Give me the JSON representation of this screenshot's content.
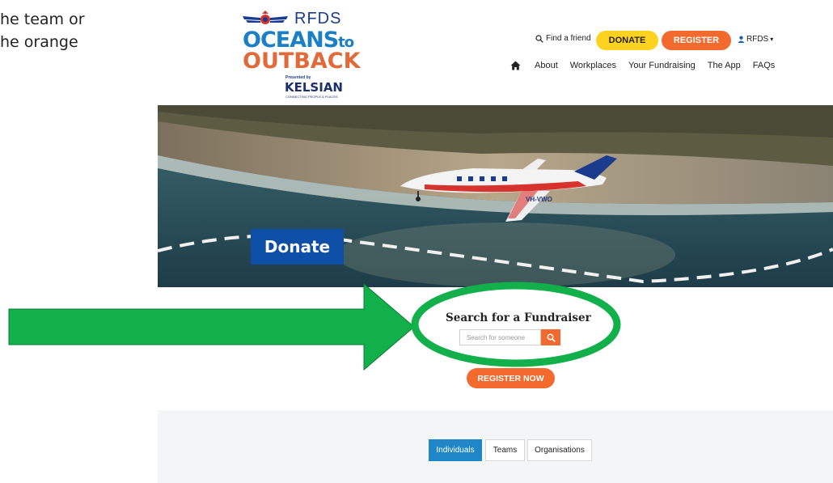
{
  "doc_fragment": {
    "line1": "he team or",
    "line2": "he orange"
  },
  "logo": {
    "rfds": "RFDS",
    "oceans": "OCEANS",
    "to": "to",
    "outback": "OUTBACK",
    "presented_by": "Presented by",
    "sponsor": "KELSIAN",
    "tagline": "CONNECTING PEOPLE & PLACES"
  },
  "top_nav": {
    "find_friend": "Find a friend",
    "donate": "DONATE",
    "register": "REGISTER",
    "user": "RFDS"
  },
  "main_nav": {
    "items": [
      "About",
      "Workplaces",
      "Your Fundraising",
      "The App",
      "FAQs"
    ]
  },
  "hero": {
    "banner": "Donate",
    "plane_reg": "VH-VWO"
  },
  "search": {
    "title": "Search for a Fundraiser",
    "placeholder": "Search for someone"
  },
  "cta": {
    "register_now": "REGISTER NOW"
  },
  "tabs": {
    "items": [
      "Individuals",
      "Teams",
      "Organisations"
    ],
    "active": "Individuals"
  },
  "colors": {
    "accent_orange": "#f26a2e",
    "donate_yellow": "#ffd21f",
    "tab_blue": "#1f86c8",
    "annotation_green": "#12b04a",
    "banner_blue": "#0d4ea6"
  }
}
